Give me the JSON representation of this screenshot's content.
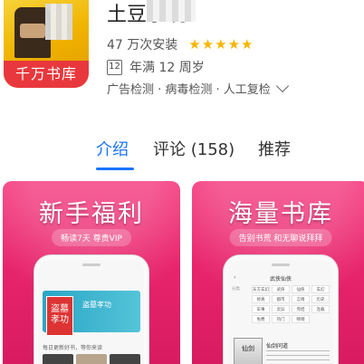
{
  "app": {
    "icon_label": "千万书库",
    "title": "土豆小说",
    "installs": "47 万次安装",
    "stars": "★★★★★",
    "rating_stars": 5,
    "age_badge": "12",
    "age_text": "年满 12 周岁",
    "checks": "广告检测 · 病毒检测 · 人工复检"
  },
  "tabs": [
    {
      "label": "介绍",
      "active": true
    },
    {
      "label": "评论 (158)",
      "active": false
    },
    {
      "label": "推荐",
      "active": false
    }
  ],
  "screenshots": [
    {
      "heading": "新手福利",
      "subtitle": "畅读7天  尊贵VIP",
      "banner_title": "盗墓孝功",
      "book_title": "盗墓 孝功",
      "row_text": "每日更新好书，等你来读"
    },
    {
      "heading": "海量书库",
      "subtitle": "告别书荒  和无聊说拜拜",
      "nav_title": "武侠仙侠",
      "grid_label_1": "分类",
      "grid_items": [
        "东方玄幻",
        "武侠",
        "仙侠",
        "玄幻",
        "修真",
        "都市",
        "言情",
        "历史",
        "军事",
        "灵异",
        "完结",
        "连载",
        "免费",
        "热门",
        "畅销"
      ],
      "cover_text": "仙剑",
      "desc_title": "仙剑问道"
    }
  ],
  "colors": {
    "accent": "#1a75ff",
    "star": "#f7b500",
    "banner_pink": "#e8256c",
    "icon_red": "#e8383d"
  }
}
